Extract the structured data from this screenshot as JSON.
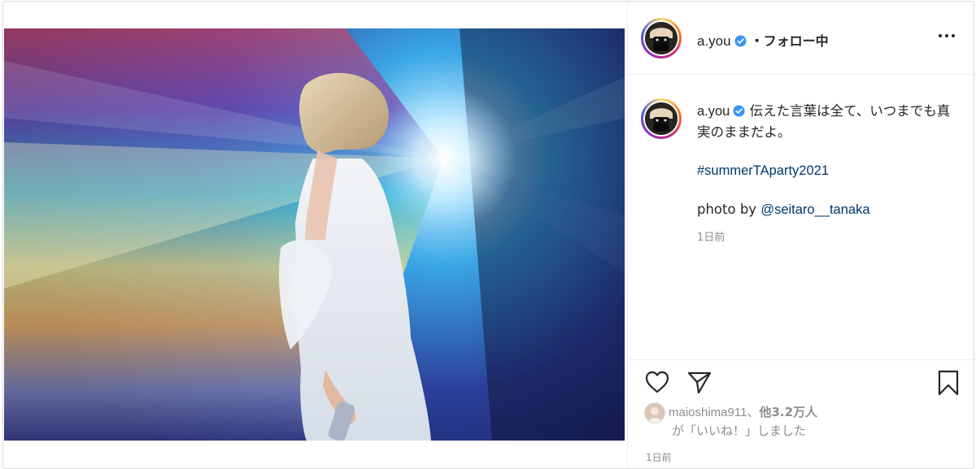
{
  "post": {
    "author": {
      "username": "a.you",
      "follow_state": "・フォロー中"
    },
    "caption": {
      "text": "伝えた言葉は全て、いつまでも真実のままだよ。",
      "hashtag": "#summerTAparty2021",
      "credit_prefix": "photo by ",
      "credit_mention": "@seitaro__tanaka",
      "time": "1日前"
    },
    "likes": {
      "first_liker": "maioshima911",
      "separator": "、",
      "others": "他3.2万人",
      "suffix": "が「いいね！」しました"
    },
    "footer_time": "1日前"
  },
  "icons": {
    "verified": "verified-badge-icon",
    "more": "more-options-icon",
    "like": "heart-icon",
    "share": "paper-plane-icon",
    "save": "bookmark-icon"
  },
  "colors": {
    "verified_blue": "#3897f0",
    "link_blue": "#00376b",
    "muted_gray": "#8e8e8e"
  }
}
